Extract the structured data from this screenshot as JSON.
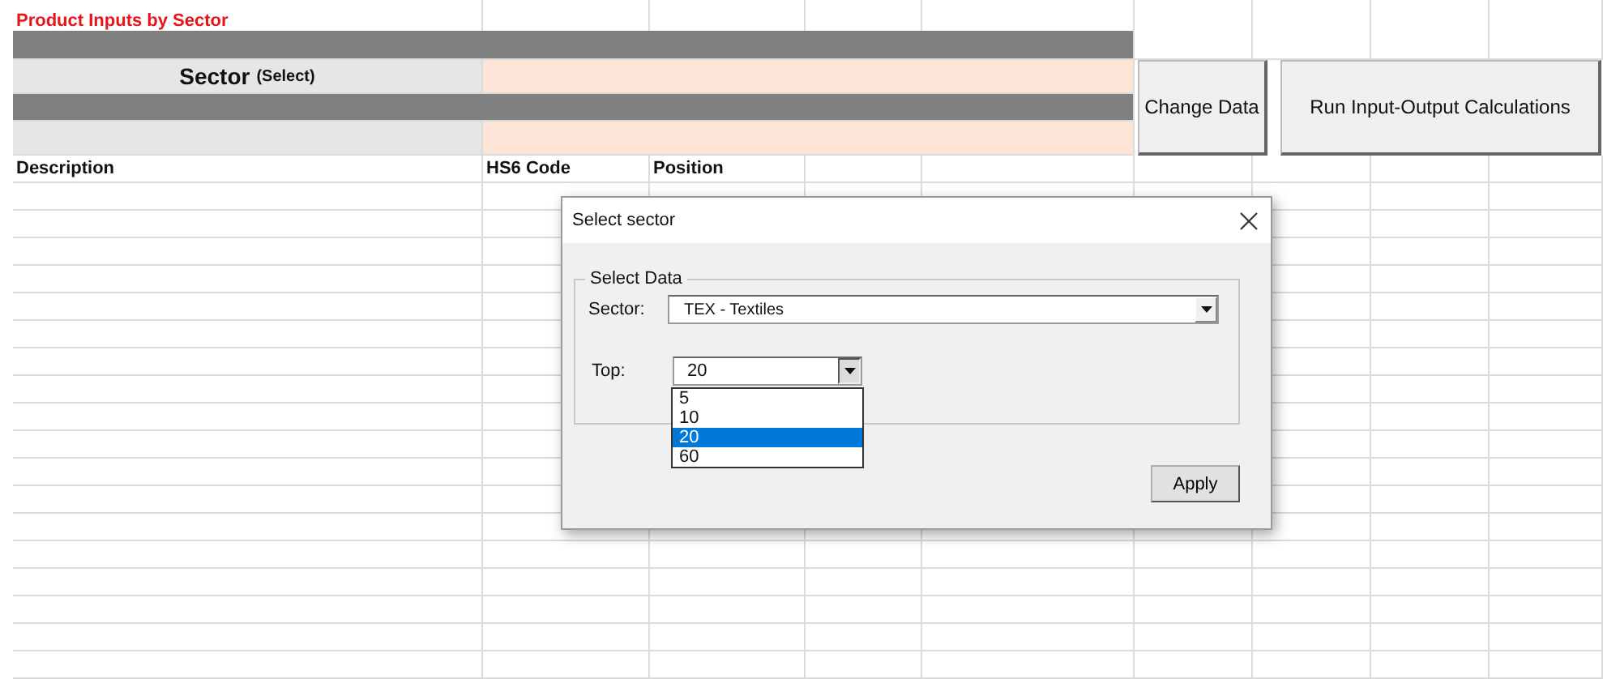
{
  "sheet": {
    "title": "Product Inputs by Sector",
    "sector_label": "Sector",
    "sector_hint": "(Select)",
    "columns": [
      "Description",
      "HS6 Code",
      "Position"
    ]
  },
  "buttons": [
    {
      "label": "Change Data"
    },
    {
      "label": "Run Input-Output Calculations"
    }
  ],
  "dialog": {
    "title": "Select sector",
    "group": "Select Data",
    "fields": [
      {
        "label": "Sector:",
        "value": "TEX - Textiles",
        "expanded": false
      },
      {
        "label": "Top:",
        "value": "20",
        "expanded": true,
        "options": [
          {
            "label": "5",
            "selected": false
          },
          {
            "label": "10",
            "selected": false
          },
          {
            "label": "20",
            "selected": true
          },
          {
            "label": "60",
            "selected": false
          }
        ]
      }
    ],
    "apply": "Apply"
  }
}
